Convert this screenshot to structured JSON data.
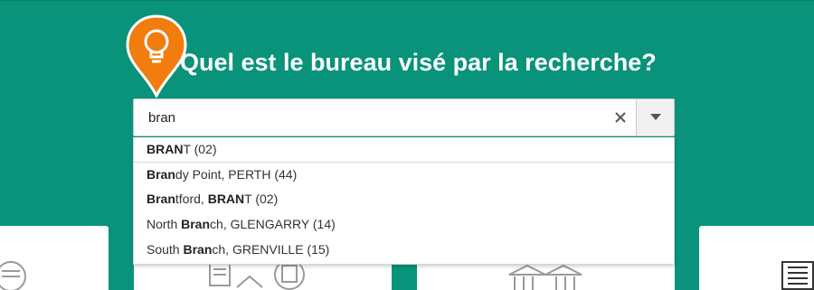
{
  "page": {
    "background_color": "#08937a",
    "accent_color": "#f07d0e",
    "question": "Quel est le bureau visé par la recherche?"
  },
  "search": {
    "value": "bran",
    "placeholder": "",
    "clear_icon": "close-icon",
    "toggle_icon": "caret-down-icon"
  },
  "dropdown": {
    "options": [
      {
        "segments": [
          {
            "text": "BRAN",
            "bold": true
          },
          {
            "text": "T (02)",
            "bold": false
          }
        ]
      },
      {
        "segments": [
          {
            "text": "Bran",
            "bold": true
          },
          {
            "text": "dy Point, PERTH (44)",
            "bold": false
          }
        ]
      },
      {
        "segments": [
          {
            "text": "Bran",
            "bold": true
          },
          {
            "text": "tford, ",
            "bold": false
          },
          {
            "text": "BRAN",
            "bold": true
          },
          {
            "text": "T (02)",
            "bold": false
          }
        ]
      },
      {
        "segments": [
          {
            "text": "North ",
            "bold": false
          },
          {
            "text": "Bran",
            "bold": true
          },
          {
            "text": "ch, GLENGARRY (14)",
            "bold": false
          }
        ]
      },
      {
        "segments": [
          {
            "text": "South ",
            "bold": false
          },
          {
            "text": "Bran",
            "bold": true
          },
          {
            "text": "ch, GRENVILLE (15)",
            "bold": false
          }
        ]
      }
    ]
  },
  "icons": {
    "pin": "lightbulb-pin-icon",
    "cards": [
      "document-circle-icon",
      "documents-house-icon",
      "building-columns-icon",
      "newspaper-icon"
    ]
  }
}
